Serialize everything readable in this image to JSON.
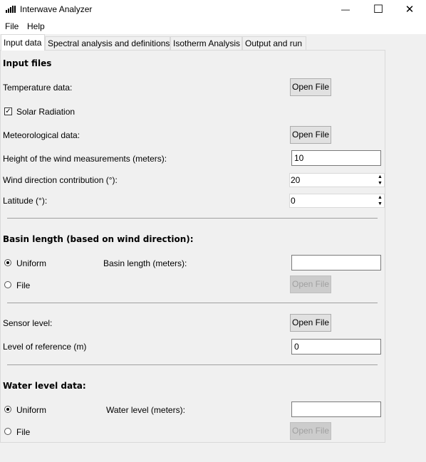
{
  "window": {
    "title": "Interwave Analyzer",
    "minimize_glyph": "—",
    "maximize_glyph": "☐",
    "close_glyph": "✕"
  },
  "menu": [
    "File",
    "Help"
  ],
  "tabs": [
    "Input data",
    "Spectral analysis and definitions",
    "Isotherm Analysis",
    "Output and run"
  ],
  "input_files": {
    "header": "Input files",
    "temperature_label": "Temperature data:",
    "temperature_button": "Open File",
    "solar_label": "Solar Radiation",
    "solar_checked": true,
    "meteo_label": "Meteorological data:",
    "meteo_button": "Open File",
    "wind_height_label": "Height of the wind measurements (meters):",
    "wind_height_value": "10",
    "wind_dir_label": "Wind direction contribution (°):",
    "wind_dir_value": "20",
    "latitude_label": "Latitude (°):",
    "latitude_value": "0"
  },
  "basin": {
    "header": "Basin length (based on wind direction):",
    "uniform_label": "Uniform",
    "file_label": "File",
    "length_label": "Basin length (meters):",
    "length_value": "",
    "file_button": "Open File",
    "selected": "Uniform"
  },
  "sensor": {
    "sensor_label": "Sensor level:",
    "sensor_button": "Open File",
    "reference_label": "Level of reference (m)",
    "reference_value": "0"
  },
  "water": {
    "header": "Water level data:",
    "uniform_label": "Uniform",
    "file_label": "File",
    "level_label": "Water level (meters):",
    "level_value": "",
    "file_button": "Open File",
    "selected": "Uniform"
  },
  "spin_up_glyph": "▲",
  "spin_down_glyph": "▼"
}
